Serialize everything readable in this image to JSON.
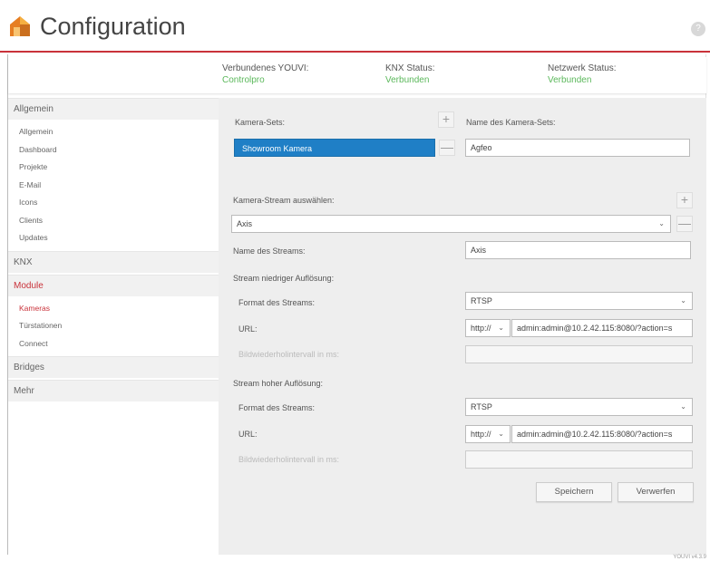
{
  "app": {
    "title": "Configuration",
    "version": "YOUVI v4.3.9",
    "help": "?"
  },
  "status": {
    "youvi_label": "Verbundenes YOUVI:",
    "youvi_value": "Controlpro",
    "knx_label": "KNX Status:",
    "knx_value": "Verbunden",
    "network_label": "Netzwerk Status:",
    "network_value": "Verbunden"
  },
  "sidebar": {
    "allgemein": {
      "label": "Allgemein",
      "items": [
        "Allgemein",
        "Dashboard",
        "Projekte",
        "E-Mail",
        "Icons",
        "Clients",
        "Updates"
      ]
    },
    "knx": "KNX",
    "module": {
      "label": "Module",
      "items": [
        "Kameras",
        "Türstationen",
        "Connect"
      ]
    },
    "bridges": "Bridges",
    "mehr": "Mehr"
  },
  "camera": {
    "sets_label": "Kamera-Sets:",
    "set_name_label": "Name des Kamera-Sets:",
    "selected_set": "Showroom Kamera",
    "set_name_value": "Agfeo",
    "stream_select_label": "Kamera-Stream auswählen:",
    "stream_selected": "Axis",
    "stream_name_label": "Name des Streams:",
    "stream_name_value": "Axis",
    "low": {
      "heading": "Stream niedriger Auflösung:",
      "format_label": "Format des Streams:",
      "format_value": "RTSP",
      "url_label": "URL:",
      "protocol": "http://",
      "url_value": "admin:admin@10.2.42.115:8080/?action=s",
      "interval_label": "Bildwiederholintervall in ms:"
    },
    "high": {
      "heading": "Stream hoher Auflösung:",
      "format_label": "Format des Streams:",
      "format_value": "RTSP",
      "url_label": "URL:",
      "protocol": "http://",
      "url_value": "admin:admin@10.2.42.115:8080/?action=s",
      "interval_label": "Bildwiederholintervall in ms:"
    },
    "save_label": "Speichern",
    "discard_label": "Verwerfen"
  },
  "icons": {
    "plus": "+",
    "minus": "—",
    "caret": "⌄"
  },
  "colors": {
    "accent": "#c9323a",
    "connected": "#5bb85b",
    "selected": "#1f7fc6"
  }
}
